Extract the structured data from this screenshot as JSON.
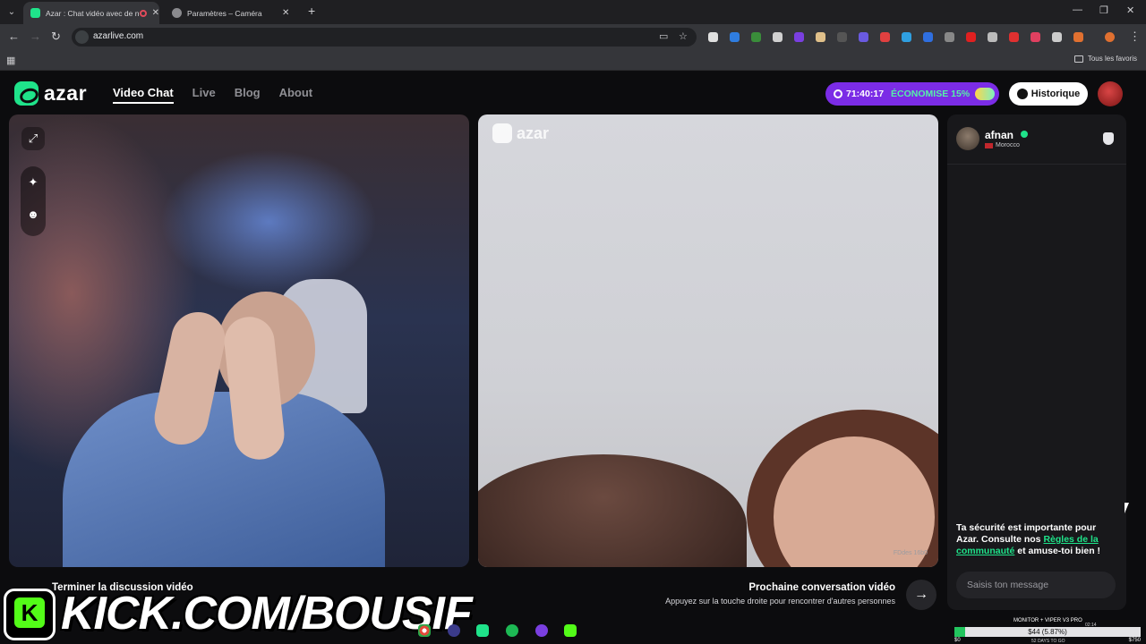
{
  "browser": {
    "tabs": [
      {
        "title": "Azar : Chat vidéo avec de n",
        "active": true,
        "favicon_color": "#1fe38a"
      },
      {
        "title": "Paramètres – Caméra",
        "active": false,
        "favicon_color": "#8a8a8e"
      }
    ],
    "url": "azarlive.com",
    "bookmarks_label": "Tous les favoris",
    "extension_colors": [
      "#e0e0e0",
      "#2f7de0",
      "#3a8d3a",
      "#d0d0d0",
      "#7a3fe0",
      "#e0c08a",
      "#555",
      "#6a5ae0",
      "#e04040",
      "#2f9fe0",
      "#2f6fe0",
      "#888",
      "#e02020",
      "#bbb",
      "#e03030",
      "#e04060",
      "#ccc",
      "#e07030"
    ]
  },
  "azar": {
    "logo_text": "azar",
    "nav": [
      "Video Chat",
      "Live",
      "Blog",
      "About"
    ],
    "promo": {
      "timer": "71:40:17",
      "discount": "ÉCONOMISE 15%"
    },
    "history_label": "Historique",
    "watermark": "azar",
    "video_code": "FDdes 16b0",
    "chat": {
      "name": "afnan",
      "country": "Morocco",
      "safety_part1": "Ta sécurité est importante pour Azar. Consulte nos ",
      "safety_link": "Règles de la communauté",
      "safety_part2": " et amuse-toi bien !",
      "input_placeholder": "Saisis ton message"
    },
    "end_call": "Terminer la discussion vidéo",
    "next_title": "Prochaine conversation vidéo",
    "next_subtitle": "Appuyez sur la touche droite pour rencontrer d'autres personnes"
  },
  "overlay": {
    "kick_text": "KICK.COM/BOUSIF",
    "monitor": {
      "title": "MONITOR + VIPER V3 PRO",
      "value": "$44 (5.87%)",
      "progress": 0.0587,
      "min": "$0",
      "mid": "52 DAYS TO GO",
      "max": "$750",
      "time": "02:14"
    }
  }
}
